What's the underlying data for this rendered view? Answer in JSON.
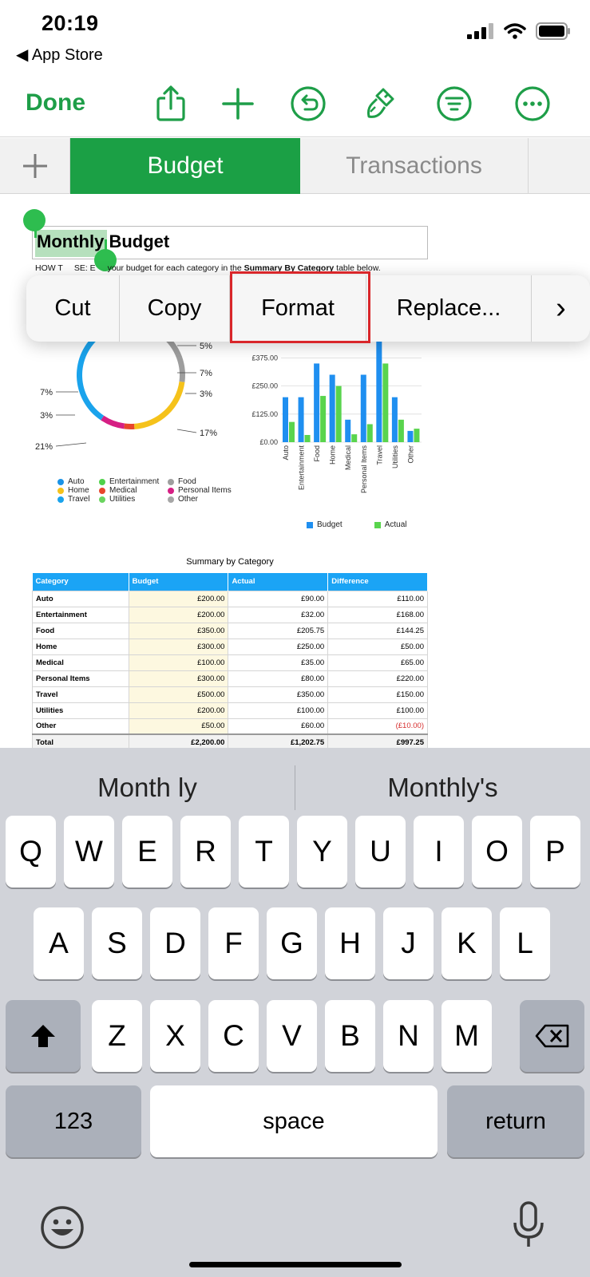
{
  "status": {
    "time": "20:19",
    "back_label": "◀ App Store"
  },
  "toolbar": {
    "done_label": "Done",
    "icons": [
      "share-icon",
      "add-icon",
      "undo-icon",
      "format-brush-icon",
      "filter-icon",
      "more-icon"
    ],
    "accent_color": "#1e9e48"
  },
  "tabs": {
    "active": "Budget",
    "inactive": "Transactions"
  },
  "sheet": {
    "title_selected": "Monthly",
    "title_rest": " Budget",
    "howto_a": "HOW T",
    "howto_b": "SE: E",
    "howto_c": " your budget for each category in the ",
    "howto_bold": "Summary By Category",
    "howto_d": " table below."
  },
  "context_menu": {
    "items": [
      "Cut",
      "Copy",
      "Format",
      "Replace..."
    ],
    "more": "›"
  },
  "chart_data": [
    {
      "type": "pie",
      "categories": [
        "Auto",
        "Entertainment",
        "Food",
        "Home",
        "Medical",
        "Personal Items",
        "Travel",
        "Utilities",
        "Other"
      ],
      "values": [
        4,
        5,
        17,
        21,
        3,
        7,
        29,
        7,
        3
      ],
      "labels": [
        "5%",
        "7%",
        "3%",
        "17%",
        "21%",
        "3%",
        "7%"
      ],
      "colors": [
        "#1a93e6",
        "#4fd24a",
        "#9e9e9e",
        "#f5c21b",
        "#e8452c",
        "#d61f84",
        "#1aa3ec",
        "#6ad45f",
        "#a6a6a6"
      ]
    },
    {
      "type": "bar",
      "categories": [
        "Auto",
        "Entertainment",
        "Food",
        "Home",
        "Medical",
        "Personal Items",
        "Travel",
        "Utilities",
        "Other"
      ],
      "series": [
        {
          "name": "Budget",
          "values": [
            200,
            200,
            350,
            300,
            100,
            300,
            500,
            200,
            50
          ],
          "color": "#1f8ff0"
        },
        {
          "name": "Actual",
          "values": [
            90,
            32,
            205.75,
            250,
            35,
            80,
            350,
            100,
            60
          ],
          "color": "#59d44d"
        }
      ],
      "y_ticks": [
        "£0.00",
        "£125.00",
        "£250.00",
        "£375.00"
      ],
      "ylim": [
        0,
        500
      ]
    }
  ],
  "table": {
    "title": "Summary by Category",
    "headers": [
      "Category",
      "Budget",
      "Actual",
      "Difference"
    ],
    "rows": [
      [
        "Auto",
        "£200.00",
        "£90.00",
        "£110.00"
      ],
      [
        "Entertainment",
        "£200.00",
        "£32.00",
        "£168.00"
      ],
      [
        "Food",
        "£350.00",
        "£205.75",
        "£144.25"
      ],
      [
        "Home",
        "£300.00",
        "£250.00",
        "£50.00"
      ],
      [
        "Medical",
        "£100.00",
        "£35.00",
        "£65.00"
      ],
      [
        "Personal Items",
        "£300.00",
        "£80.00",
        "£220.00"
      ],
      [
        "Travel",
        "£500.00",
        "£350.00",
        "£150.00"
      ],
      [
        "Utilities",
        "£200.00",
        "£100.00",
        "£100.00"
      ],
      [
        "Other",
        "£50.00",
        "£60.00",
        "(£10.00)"
      ]
    ],
    "total": [
      "Total",
      "£2,200.00",
      "£1,202.75",
      "£997.25"
    ]
  },
  "keyboard": {
    "suggestions": [
      "Month ly",
      "Monthly's"
    ],
    "row1": [
      "Q",
      "W",
      "E",
      "R",
      "T",
      "Y",
      "U",
      "I",
      "O",
      "P"
    ],
    "row2": [
      "A",
      "S",
      "D",
      "F",
      "G",
      "H",
      "J",
      "K",
      "L"
    ],
    "row3": [
      "Z",
      "X",
      "C",
      "V",
      "B",
      "N",
      "M"
    ],
    "numbers_label": "123",
    "space_label": "space",
    "return_label": "return"
  }
}
